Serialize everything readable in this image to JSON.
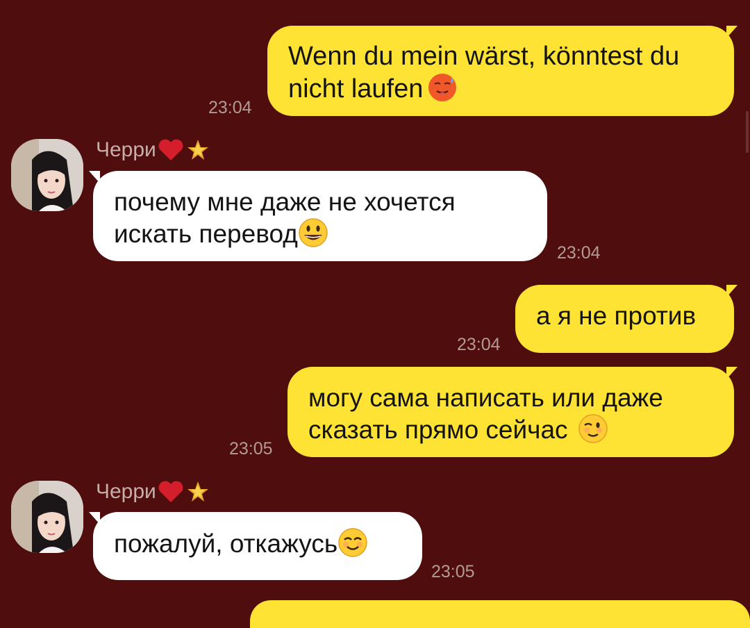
{
  "messages": [
    {
      "direction": "out",
      "line1": "Wenn du mein wärst, könntest du",
      "line2": "nicht laufen",
      "emoji": "hot-face-icon",
      "time": "23:04"
    },
    {
      "direction": "in",
      "sender": "Черри",
      "line1": "почему мне даже не хочется",
      "line2": "искать перевод",
      "emoji": "grinning-face-icon",
      "time": "23:04"
    },
    {
      "direction": "out",
      "line1": "а я не против",
      "time": "23:04"
    },
    {
      "direction": "out",
      "line1": "могу сама написать или даже",
      "line2": "сказать прямо сейчас",
      "emoji": "winking-face-icon",
      "time": "23:05"
    },
    {
      "direction": "in",
      "sender": "Черри",
      "line1": "пожалуй, откажусь",
      "emoji": "smiling-face-icon",
      "time": "23:05"
    }
  ],
  "colors": {
    "background": "#4f0d0d",
    "outgoing_bubble": "#fee234",
    "incoming_bubble": "#ffffff",
    "timestamp": "#b29a95",
    "sender_name": "#c8aeaa"
  }
}
